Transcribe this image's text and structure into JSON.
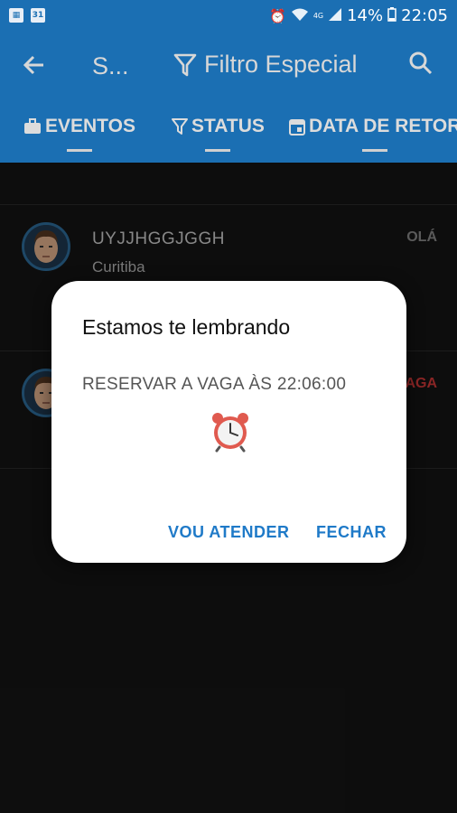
{
  "status_bar": {
    "battery": "14%",
    "time": "22:05",
    "network": "4G",
    "calendar_day": "31"
  },
  "app_bar": {
    "title": "S...",
    "filter_label": "Filtro Especial"
  },
  "tabs": [
    {
      "label": "EVENTOS",
      "icon": "briefcase-icon"
    },
    {
      "label": "STATUS",
      "icon": "filter-icon"
    },
    {
      "label": "DATA DE RETOR",
      "icon": "calendar-icon"
    }
  ],
  "list": [
    {
      "name": "UYJJHGGJGGH",
      "city": "Curitiba",
      "tag": "OLÁ",
      "tag_color": "#8a8a8a"
    },
    {
      "name": "",
      "city": "",
      "tag": "AGA",
      "tag_color": "#d43a3a"
    }
  ],
  "dialog": {
    "title": "Estamos te lembrando",
    "message": "RESERVAR A VAGA ÀS 22:06:00",
    "icon": "alarm-clock-icon",
    "primary_button": "VOU ATENDER",
    "secondary_button": "FECHAR"
  },
  "colors": {
    "primary": "#1b6fb3",
    "accent": "#1f7ac8",
    "alert": "#d43a3a",
    "background": "#151515"
  }
}
